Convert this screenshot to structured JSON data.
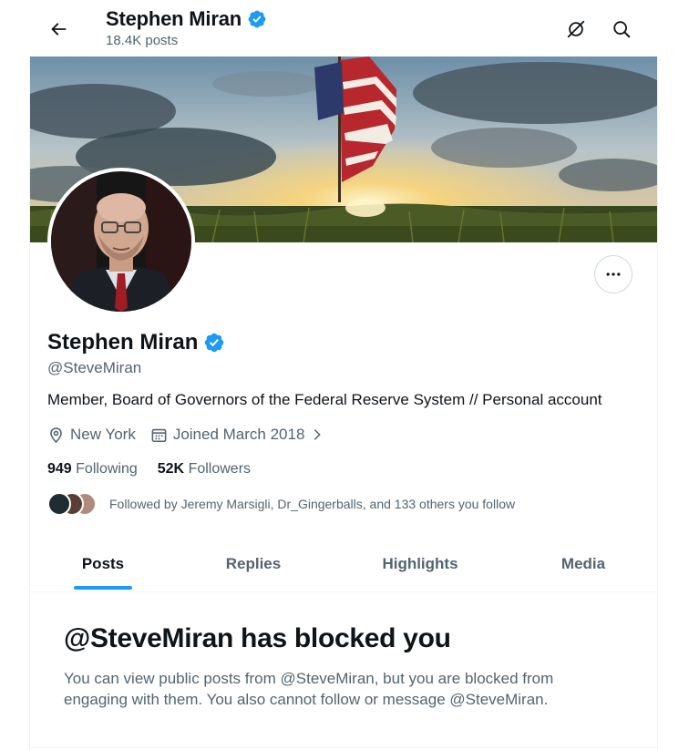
{
  "header": {
    "name": "Stephen Miran",
    "posts_count": "18.4K posts",
    "icons": [
      "back-arrow-icon",
      "grok-icon",
      "search-icon"
    ]
  },
  "profile": {
    "name": "Stephen Miran",
    "handle": "@SteveMiran",
    "bio": "Member, Board of Governors of the Federal Reserve System // Personal account",
    "location": "New York",
    "joined": "Joined March 2018",
    "following_count": "949",
    "following_label": "Following",
    "followers_count": "52K",
    "followers_label": "Followers",
    "followed_by": "Followed by Jeremy Marsigli, Dr_Gingerballs, and 133 others you follow",
    "verified_color": "#1d9bf0"
  },
  "tabs": [
    {
      "label": "Posts",
      "active": true
    },
    {
      "label": "Replies",
      "active": false
    },
    {
      "label": "Highlights",
      "active": false
    },
    {
      "label": "Media",
      "active": false
    }
  ],
  "blocked": {
    "title": "@SteveMiran has blocked you",
    "message": "You can view public posts from @SteveMiran, but you are blocked from engaging with them. You also cannot follow or message @SteveMiran."
  },
  "colors": {
    "accent": "#1d9bf0",
    "text_primary": "#0f1419",
    "text_secondary": "#536471"
  }
}
